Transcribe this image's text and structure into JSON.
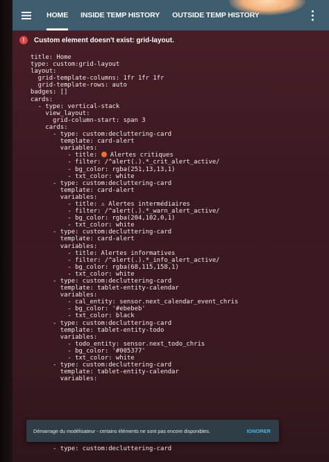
{
  "topbar": {
    "tabs": [
      {
        "label": "HOME",
        "active": true
      },
      {
        "label": "INSIDE TEMP HISTORY",
        "active": false
      },
      {
        "label": "OUTSIDE TEMP HISTORY",
        "active": false
      }
    ]
  },
  "error": {
    "message": "Custom element doesn't exist: grid-layout."
  },
  "yaml_lines": [
    "title: Home",
    "type: custom:grid-layout",
    "layout:",
    "  grid-template-columns: 1fr 1fr 1fr",
    "  grid-template-rows: auto",
    "badges: []",
    "cards:",
    "  - type: vertical-stack",
    "    view_layout:",
    "      grid-column-start: span 3",
    "    cards:",
    "      - type: custom:decluttering-card",
    "        template: card-alert",
    "        variables:",
    "          - title: ● Alertes critiques",
    "          - filter: /^alert(.).*_crit_alert_active/",
    "          - bg_color: rgba(251,13,13,1)",
    "          - txt_color: white",
    "      - type: custom:decluttering-card",
    "        template: card-alert",
    "        variables:",
    "          - title: ⚠ Alertes intermédiaires",
    "          - filter: /^alert(.).*_warn_alert_active/",
    "          - bg_color: rgba(204,102,0,1)",
    "          - txt_color: white",
    "      - type: custom:decluttering-card",
    "        template: card-alert",
    "        variables:",
    "          - title: Alertes informatives",
    "          - filter: /^alert(.).*_info_alert_active/",
    "          - bg_color: rgba(68,115,158,1)",
    "          - txt_color: white",
    "      - type: custom:decluttering-card",
    "        template: tablet-entity-calendar",
    "        variables:",
    "          - cal_entity: sensor.next_calendar_event_chris",
    "          - bg_color: '#ebebeb'",
    "          - txt_color: black",
    "      - type: custom:decluttering-card",
    "        template: tablet-entity-todo",
    "        variables:",
    "          - todo_entity: sensor.next_todo_chris",
    "          - bg_color: '#005377'",
    "          - txt_color: white",
    "      - type: custom:decluttering-card",
    "        template: tablet-entity-calendar",
    "        variables:"
  ],
  "toast": {
    "message": "Démarrage du modélisateur - certains éléments ne sont pas encore disponibles.",
    "action": "IGNORER"
  },
  "bottom_line": "      - type: custom:decluttering-card",
  "colors": {
    "topbar": "#3e5d6e",
    "error_icon": "#e54343",
    "background": "#3b1920",
    "toast_action": "#4fb3e8",
    "crit_dot": "#f26c3a"
  }
}
